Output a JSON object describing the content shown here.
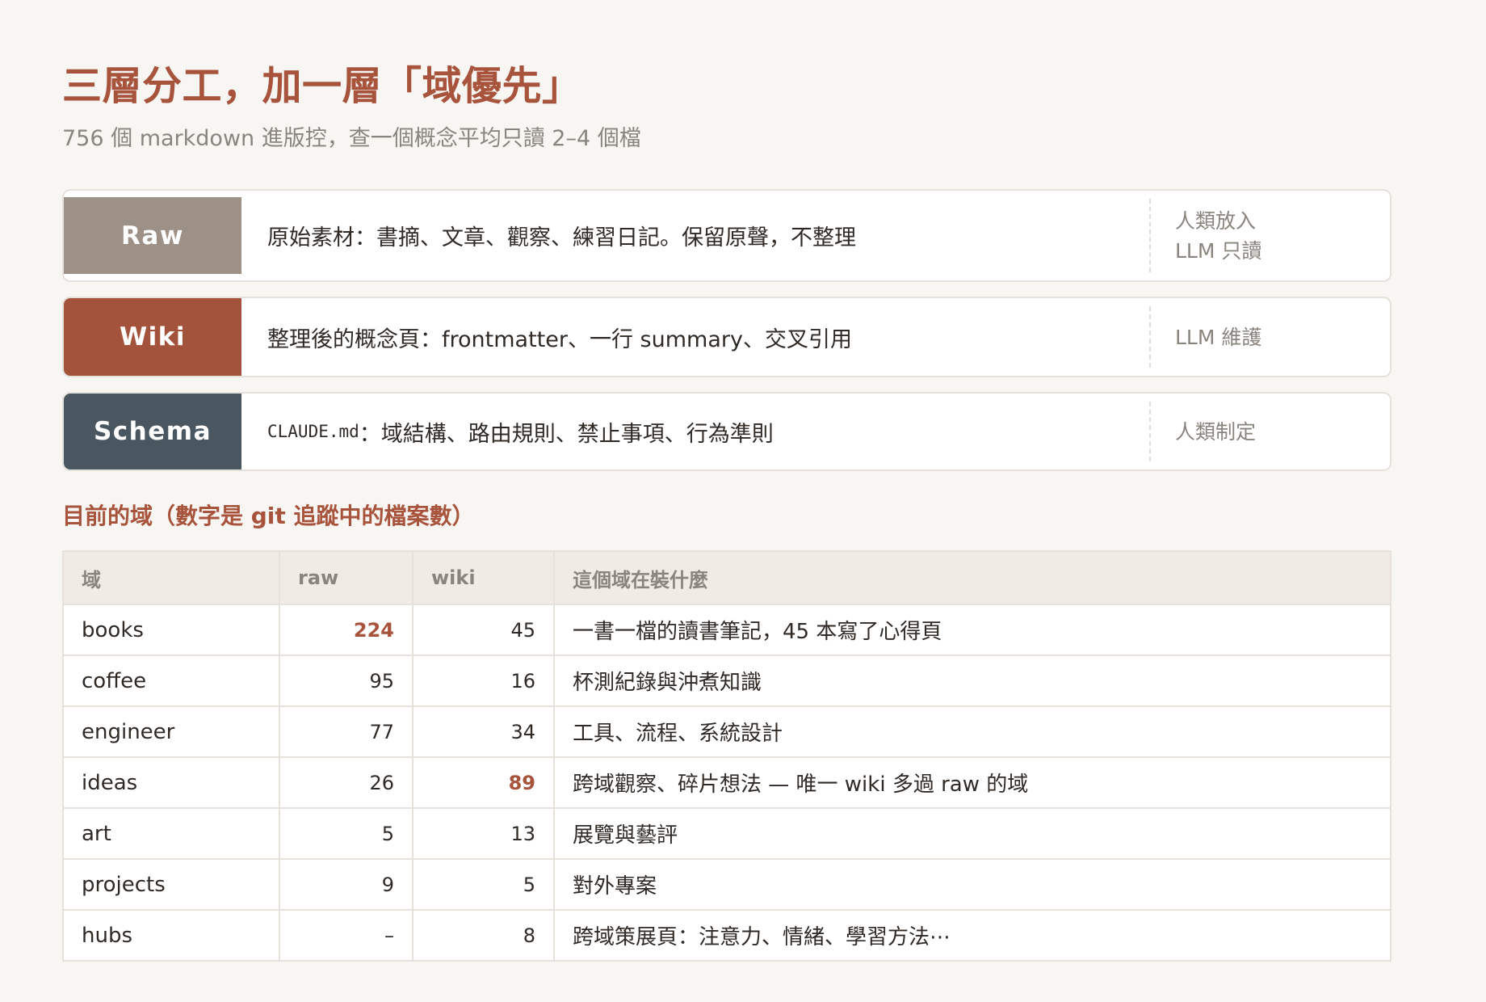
{
  "header": {
    "title": "三層分工，加一層「域優先」",
    "subtitle": "756 個 markdown 進版控，查一個概念平均只讀 2–4 個檔"
  },
  "layers": [
    {
      "name": "Raw",
      "description": "原始素材：書摘、文章、觀察、練習日記。保留原聲，不整理",
      "owner_line1": "人類放入",
      "owner_line2": "LLM 只讀"
    },
    {
      "name": "Wiki",
      "description": "整理後的概念頁：frontmatter、一行 summary、交叉引用",
      "owner_line1": "LLM 維護"
    },
    {
      "name": "Schema",
      "description_code": "CLAUDE.md",
      "description": "：域結構、路由規則、禁止事項、行為準則",
      "owner_line1": "人類制定"
    }
  ],
  "domains_section": {
    "heading": "目前的域（數字是 git 追蹤中的檔案數）",
    "columns": [
      "域",
      "raw",
      "wiki",
      "這個域在裝什麼"
    ],
    "rows": [
      {
        "domain": "books",
        "raw": "224",
        "wiki": "45",
        "desc": "一書一檔的讀書筆記，45 本寫了心得頁"
      },
      {
        "domain": "coffee",
        "raw": "95",
        "wiki": "16",
        "desc": "杯測紀錄與沖煮知識"
      },
      {
        "domain": "engineer",
        "raw": "77",
        "wiki": "34",
        "desc": "工具、流程、系統設計"
      },
      {
        "domain": "ideas",
        "raw": "26",
        "wiki": "89",
        "desc": "跨域觀察、碎片想法 — 唯一 wiki 多過 raw 的域"
      },
      {
        "domain": "art",
        "raw": "5",
        "wiki": "13",
        "desc": "展覽與藝評"
      },
      {
        "domain": "projects",
        "raw": "9",
        "wiki": "5",
        "desc": "對外專案"
      },
      {
        "domain": "hubs",
        "raw": "–",
        "wiki": "8",
        "desc": "跨域策展頁：注意力、情緒、學習方法⋯"
      }
    ]
  },
  "colors": {
    "accent": "#a8543d",
    "raw_badge": "#9c9087",
    "wiki_badge": "#a3533c",
    "schema_badge": "#4a5760",
    "background": "#f8f6f3"
  }
}
